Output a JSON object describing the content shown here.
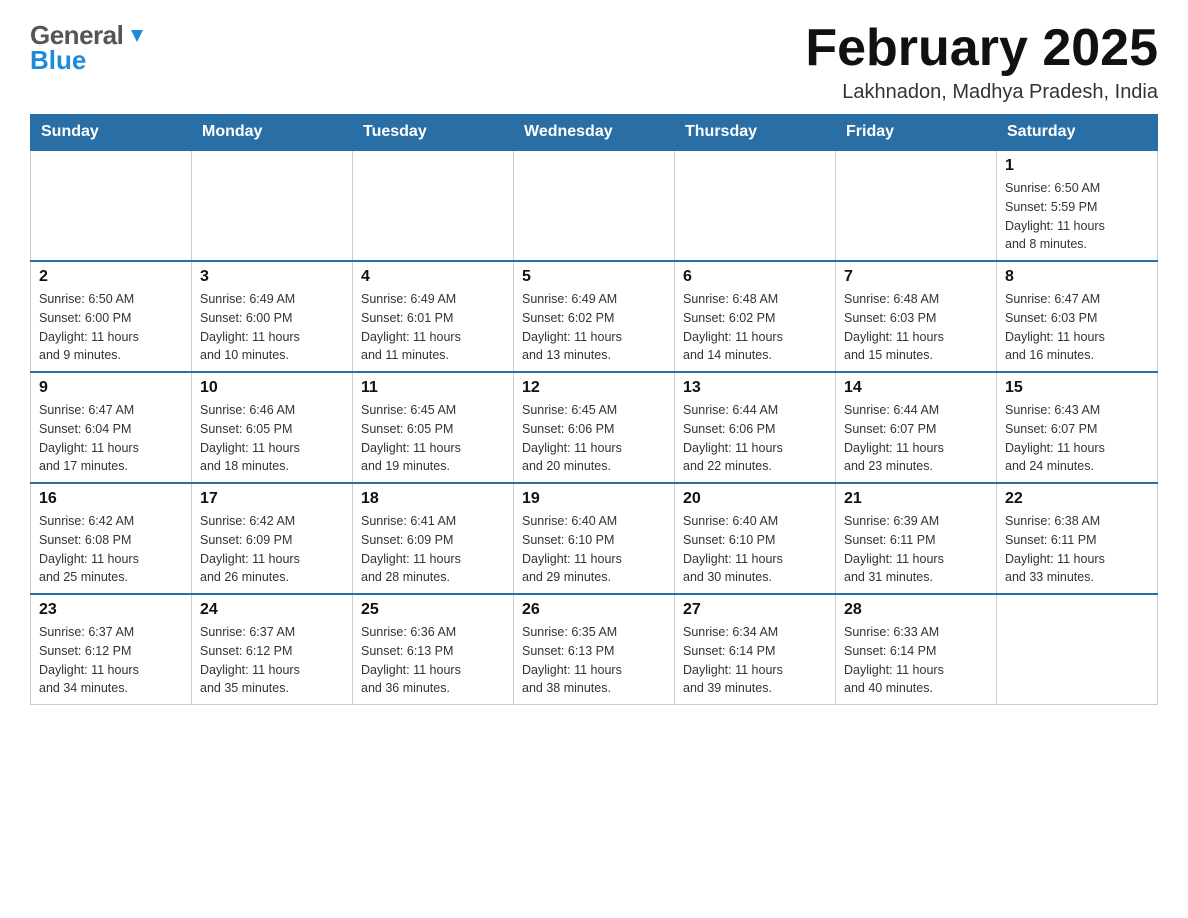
{
  "header": {
    "logo_general": "General",
    "logo_blue": "Blue",
    "title": "February 2025",
    "subtitle": "Lakhnadon, Madhya Pradesh, India"
  },
  "weekdays": [
    "Sunday",
    "Monday",
    "Tuesday",
    "Wednesday",
    "Thursday",
    "Friday",
    "Saturday"
  ],
  "weeks": [
    [
      {
        "day": "",
        "info": ""
      },
      {
        "day": "",
        "info": ""
      },
      {
        "day": "",
        "info": ""
      },
      {
        "day": "",
        "info": ""
      },
      {
        "day": "",
        "info": ""
      },
      {
        "day": "",
        "info": ""
      },
      {
        "day": "1",
        "info": "Sunrise: 6:50 AM\nSunset: 5:59 PM\nDaylight: 11 hours\nand 8 minutes."
      }
    ],
    [
      {
        "day": "2",
        "info": "Sunrise: 6:50 AM\nSunset: 6:00 PM\nDaylight: 11 hours\nand 9 minutes."
      },
      {
        "day": "3",
        "info": "Sunrise: 6:49 AM\nSunset: 6:00 PM\nDaylight: 11 hours\nand 10 minutes."
      },
      {
        "day": "4",
        "info": "Sunrise: 6:49 AM\nSunset: 6:01 PM\nDaylight: 11 hours\nand 11 minutes."
      },
      {
        "day": "5",
        "info": "Sunrise: 6:49 AM\nSunset: 6:02 PM\nDaylight: 11 hours\nand 13 minutes."
      },
      {
        "day": "6",
        "info": "Sunrise: 6:48 AM\nSunset: 6:02 PM\nDaylight: 11 hours\nand 14 minutes."
      },
      {
        "day": "7",
        "info": "Sunrise: 6:48 AM\nSunset: 6:03 PM\nDaylight: 11 hours\nand 15 minutes."
      },
      {
        "day": "8",
        "info": "Sunrise: 6:47 AM\nSunset: 6:03 PM\nDaylight: 11 hours\nand 16 minutes."
      }
    ],
    [
      {
        "day": "9",
        "info": "Sunrise: 6:47 AM\nSunset: 6:04 PM\nDaylight: 11 hours\nand 17 minutes."
      },
      {
        "day": "10",
        "info": "Sunrise: 6:46 AM\nSunset: 6:05 PM\nDaylight: 11 hours\nand 18 minutes."
      },
      {
        "day": "11",
        "info": "Sunrise: 6:45 AM\nSunset: 6:05 PM\nDaylight: 11 hours\nand 19 minutes."
      },
      {
        "day": "12",
        "info": "Sunrise: 6:45 AM\nSunset: 6:06 PM\nDaylight: 11 hours\nand 20 minutes."
      },
      {
        "day": "13",
        "info": "Sunrise: 6:44 AM\nSunset: 6:06 PM\nDaylight: 11 hours\nand 22 minutes."
      },
      {
        "day": "14",
        "info": "Sunrise: 6:44 AM\nSunset: 6:07 PM\nDaylight: 11 hours\nand 23 minutes."
      },
      {
        "day": "15",
        "info": "Sunrise: 6:43 AM\nSunset: 6:07 PM\nDaylight: 11 hours\nand 24 minutes."
      }
    ],
    [
      {
        "day": "16",
        "info": "Sunrise: 6:42 AM\nSunset: 6:08 PM\nDaylight: 11 hours\nand 25 minutes."
      },
      {
        "day": "17",
        "info": "Sunrise: 6:42 AM\nSunset: 6:09 PM\nDaylight: 11 hours\nand 26 minutes."
      },
      {
        "day": "18",
        "info": "Sunrise: 6:41 AM\nSunset: 6:09 PM\nDaylight: 11 hours\nand 28 minutes."
      },
      {
        "day": "19",
        "info": "Sunrise: 6:40 AM\nSunset: 6:10 PM\nDaylight: 11 hours\nand 29 minutes."
      },
      {
        "day": "20",
        "info": "Sunrise: 6:40 AM\nSunset: 6:10 PM\nDaylight: 11 hours\nand 30 minutes."
      },
      {
        "day": "21",
        "info": "Sunrise: 6:39 AM\nSunset: 6:11 PM\nDaylight: 11 hours\nand 31 minutes."
      },
      {
        "day": "22",
        "info": "Sunrise: 6:38 AM\nSunset: 6:11 PM\nDaylight: 11 hours\nand 33 minutes."
      }
    ],
    [
      {
        "day": "23",
        "info": "Sunrise: 6:37 AM\nSunset: 6:12 PM\nDaylight: 11 hours\nand 34 minutes."
      },
      {
        "day": "24",
        "info": "Sunrise: 6:37 AM\nSunset: 6:12 PM\nDaylight: 11 hours\nand 35 minutes."
      },
      {
        "day": "25",
        "info": "Sunrise: 6:36 AM\nSunset: 6:13 PM\nDaylight: 11 hours\nand 36 minutes."
      },
      {
        "day": "26",
        "info": "Sunrise: 6:35 AM\nSunset: 6:13 PM\nDaylight: 11 hours\nand 38 minutes."
      },
      {
        "day": "27",
        "info": "Sunrise: 6:34 AM\nSunset: 6:14 PM\nDaylight: 11 hours\nand 39 minutes."
      },
      {
        "day": "28",
        "info": "Sunrise: 6:33 AM\nSunset: 6:14 PM\nDaylight: 11 hours\nand 40 minutes."
      },
      {
        "day": "",
        "info": ""
      }
    ]
  ]
}
